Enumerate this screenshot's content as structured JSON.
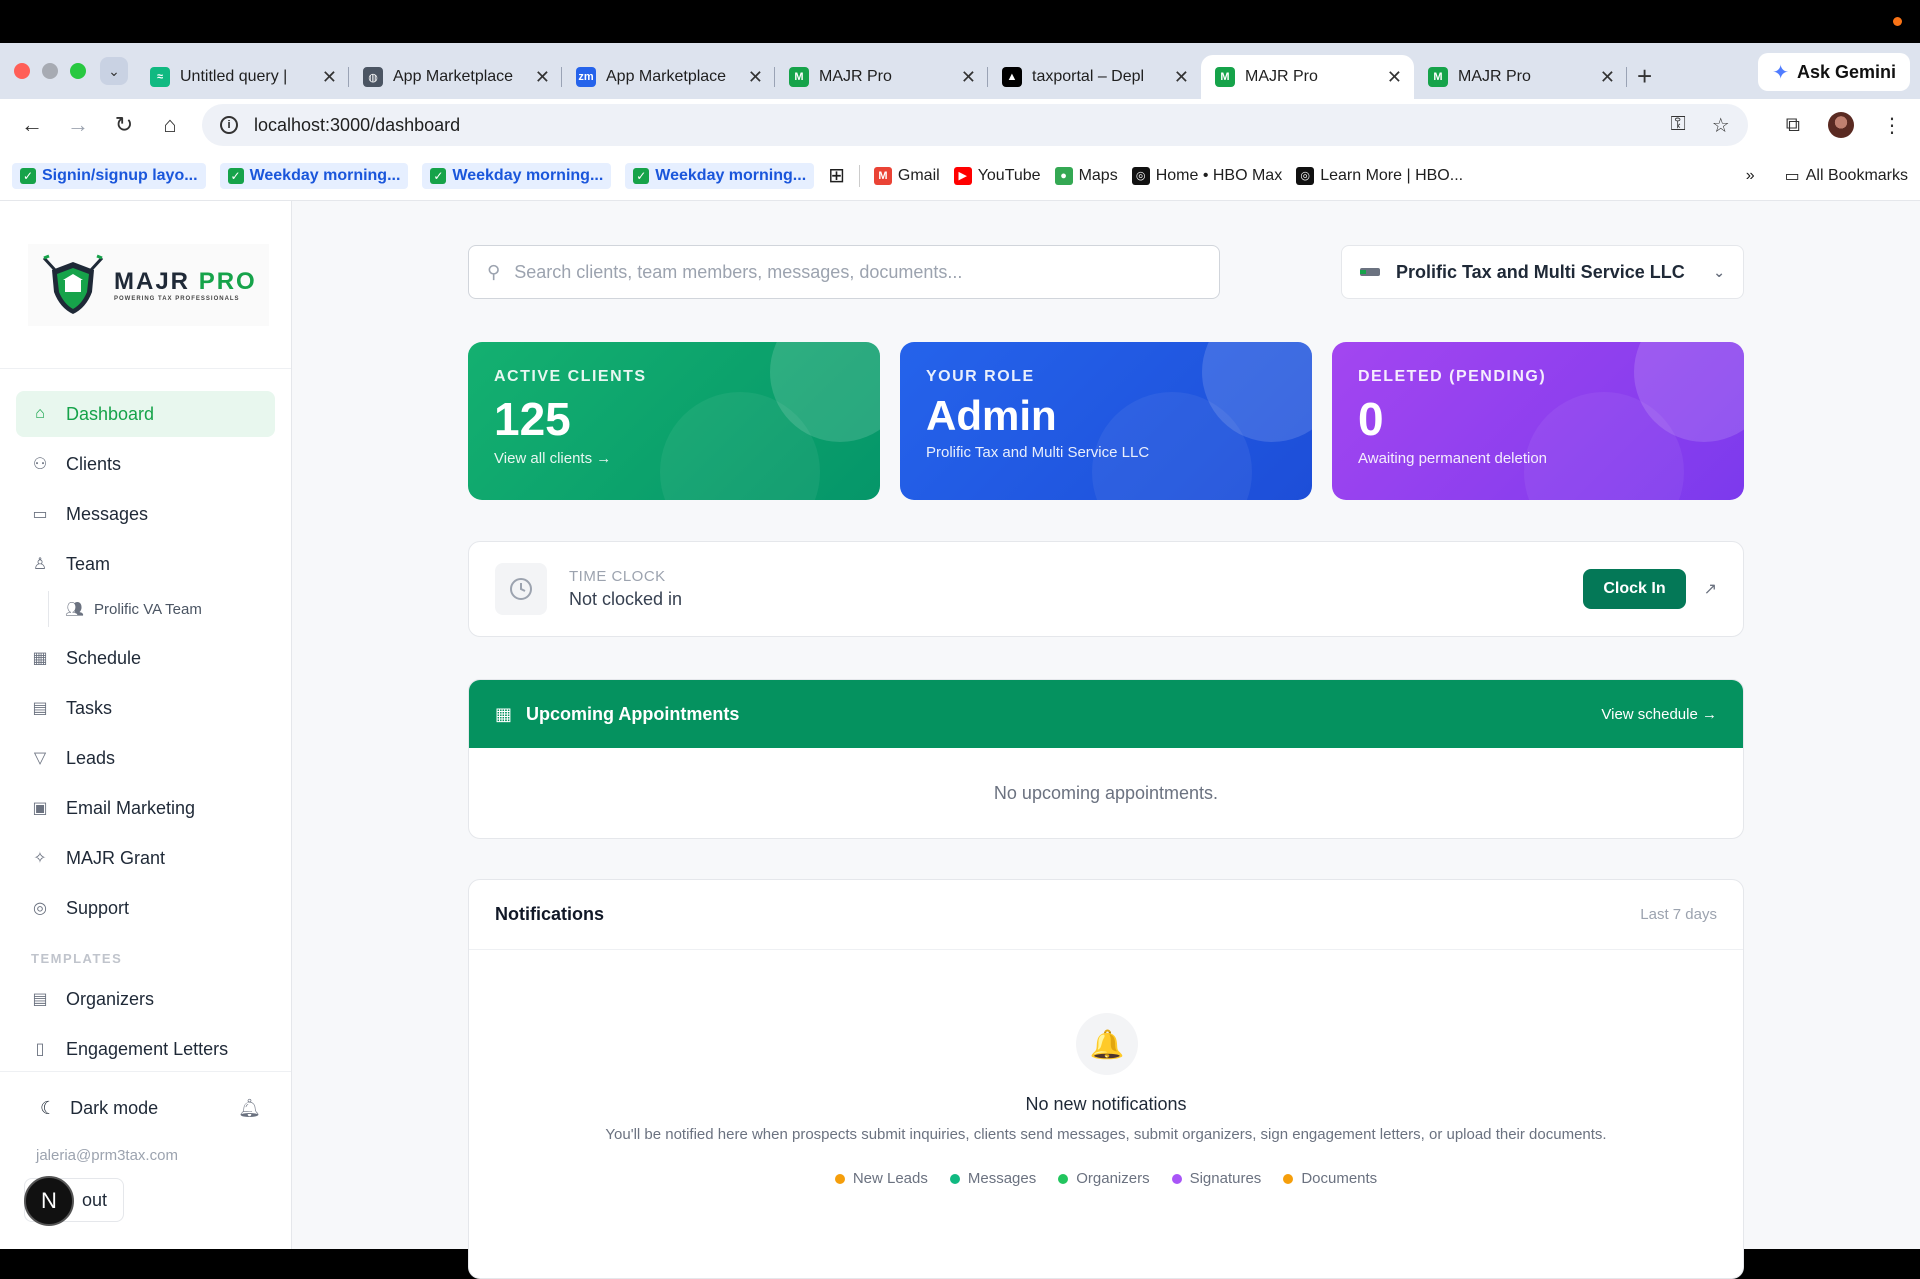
{
  "browser": {
    "tabs": [
      {
        "title": "Untitled query | ",
        "color": "#10b981",
        "fav": "≈",
        "active": false
      },
      {
        "title": "App Marketplace",
        "color": "#4b5563",
        "fav": "◍",
        "active": false
      },
      {
        "title": "App Marketplace",
        "color": "#2563eb",
        "fav": "zm",
        "active": false
      },
      {
        "title": "MAJR Pro",
        "color": "#16a34a",
        "fav": "M",
        "active": false
      },
      {
        "title": "taxportal – Depl",
        "color": "#000000",
        "fav": "▲",
        "active": false
      },
      {
        "title": "MAJR Pro",
        "color": "#16a34a",
        "fav": "M",
        "active": true
      },
      {
        "title": "MAJR Pro",
        "color": "#16a34a",
        "fav": "M",
        "active": false
      }
    ],
    "ask_gemini": "Ask Gemini",
    "url": "localhost:3000/dashboard",
    "bookmarks": [
      {
        "label": "Signin/signup layo...",
        "type": "check"
      },
      {
        "label": "Weekday morning...",
        "type": "check"
      },
      {
        "label": "Weekday morning...",
        "type": "check"
      },
      {
        "label": "Weekday morning...",
        "type": "check"
      }
    ],
    "bookmarks_plain": [
      {
        "label": "Gmail",
        "color": "#ea4335",
        "fav": "M"
      },
      {
        "label": "YouTube",
        "color": "#ff0000",
        "fav": "▶"
      },
      {
        "label": "Maps",
        "color": "#34a853",
        "fav": "●"
      },
      {
        "label": "Home • HBO Max",
        "color": "#111111",
        "fav": "◎"
      },
      {
        "label": "Learn More | HBO...",
        "color": "#111111",
        "fav": "◎"
      }
    ],
    "all_bookmarks": "All Bookmarks"
  },
  "sidebar": {
    "logo_main": "MAJR",
    "logo_pro": "PRO",
    "logo_tagline": "POWERING TAX PROFESSIONALS",
    "items": [
      {
        "label": "Dashboard",
        "icon": "home-icon",
        "glyph": "⌂",
        "active": true
      },
      {
        "label": "Clients",
        "icon": "users-icon",
        "glyph": "⚇",
        "active": false
      },
      {
        "label": "Messages",
        "icon": "message-icon",
        "glyph": "▭",
        "active": false
      },
      {
        "label": "Team",
        "icon": "team-icon",
        "glyph": "♙",
        "active": false
      }
    ],
    "sub_item": "Prolific VA Team",
    "items2": [
      {
        "label": "Schedule",
        "icon": "calendar-icon",
        "glyph": "▦"
      },
      {
        "label": "Tasks",
        "icon": "clipboard-icon",
        "glyph": "▤"
      },
      {
        "label": "Leads",
        "icon": "filter-icon",
        "glyph": "▽"
      },
      {
        "label": "Email Marketing",
        "icon": "newsletter-icon",
        "glyph": "▣"
      },
      {
        "label": "MAJR Grant",
        "icon": "sparkle-icon",
        "glyph": "✧"
      },
      {
        "label": "Support",
        "icon": "lifebuoy-icon",
        "glyph": "◎"
      }
    ],
    "templates_label": "TEMPLATES",
    "templates": [
      {
        "label": "Organizers",
        "icon": "clipboard-list-icon",
        "glyph": "▤"
      },
      {
        "label": "Engagement Letters",
        "icon": "document-icon",
        "glyph": "▯"
      }
    ],
    "dark_mode": "Dark mode",
    "email": "jaleria@prm3tax.com",
    "signout": "out"
  },
  "main": {
    "search_placeholder": "Search clients, team members, messages, documents...",
    "org_name": "Prolific Tax and Multi Service LLC",
    "cards": {
      "clients": {
        "label": "ACTIVE CLIENTS",
        "value": "125",
        "sub": "View all clients →"
      },
      "role": {
        "label": "YOUR ROLE",
        "value": "Admin",
        "sub": "Prolific Tax and Multi Service LLC"
      },
      "deleted": {
        "label": "DELETED (PENDING)",
        "value": "0",
        "sub": "Awaiting permanent deletion"
      }
    },
    "timeclock": {
      "label": "TIME CLOCK",
      "status": "Not clocked in",
      "button": "Clock In"
    },
    "appointments": {
      "title": "Upcoming Appointments",
      "link": "View schedule →",
      "empty": "No upcoming appointments."
    },
    "notifications": {
      "title": "Notifications",
      "range": "Last 7 days",
      "empty_title": "No new notifications",
      "empty_desc": "You'll be notified here when prospects submit inquiries, clients send messages, submit organizers, sign engagement letters, or upload their documents.",
      "legend": [
        {
          "label": "New Leads",
          "color": "#f59e0b"
        },
        {
          "label": "Messages",
          "color": "#10b981"
        },
        {
          "label": "Organizers",
          "color": "#22c55e"
        },
        {
          "label": "Signatures",
          "color": "#a855f7"
        },
        {
          "label": "Documents",
          "color": "#f59e0b"
        }
      ]
    }
  }
}
